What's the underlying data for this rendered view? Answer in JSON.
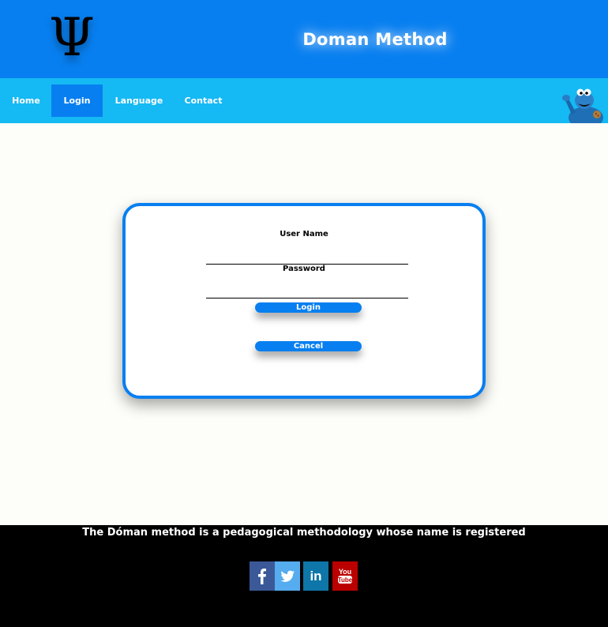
{
  "header": {
    "logo_symbol": "Ψ",
    "title": "Doman Method"
  },
  "nav": {
    "items": [
      {
        "label": "Home",
        "active": false
      },
      {
        "label": "Login",
        "active": true
      },
      {
        "label": "Language",
        "active": false
      },
      {
        "label": "Contact",
        "active": false
      }
    ],
    "mascot_icon": "cookie-monster-mascot"
  },
  "login": {
    "username_label": "User Name",
    "username_value": "",
    "password_label": "Password",
    "password_value": "",
    "login_button": "Login",
    "cancel_button": "Cancel"
  },
  "footer": {
    "text": "The Dóman method is a pedagogical methodology whose name is registered",
    "social": [
      {
        "icon": "facebook-icon",
        "glyph": "f",
        "color": "#3b5998"
      },
      {
        "icon": "twitter-icon",
        "glyph": "bird",
        "color": "#55acee"
      },
      {
        "icon": "linkedin-icon",
        "glyph": "in",
        "color": "#0e76a8"
      },
      {
        "icon": "youtube-icon",
        "glyph": "You Tube",
        "color": "#bb0000"
      }
    ]
  },
  "colors": {
    "primary": "#087ff0",
    "nav": "#15b9f4",
    "footer": "#000000",
    "page": "#fdfdf9"
  }
}
